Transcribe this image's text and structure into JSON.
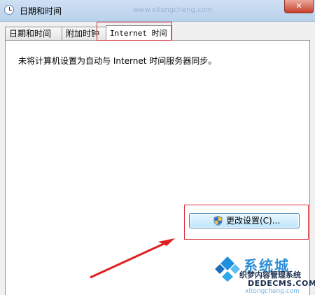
{
  "window": {
    "title": "日期和时间",
    "close_symbol": "✕",
    "watermark": "www.xitongcheng.com"
  },
  "tabs": [
    {
      "label": "日期和时间"
    },
    {
      "label": "附加时钟"
    },
    {
      "label": "Internet 时间",
      "selected": true
    }
  ],
  "panel": {
    "status_text": "未将计算机设置为自动与 Internet 时间服务器同步。",
    "change_button_label": "更改设置(C)...",
    "change_button_icon": "uac-shield-icon"
  },
  "watermark_logo": {
    "brand": "系统城",
    "line1": "织梦内容管理系统",
    "line2": "DEDECMS.COM",
    "line3": "xitongcheng.com"
  },
  "colors": {
    "annotation_red": "#d9303a",
    "button_border": "#3c7fb1"
  }
}
